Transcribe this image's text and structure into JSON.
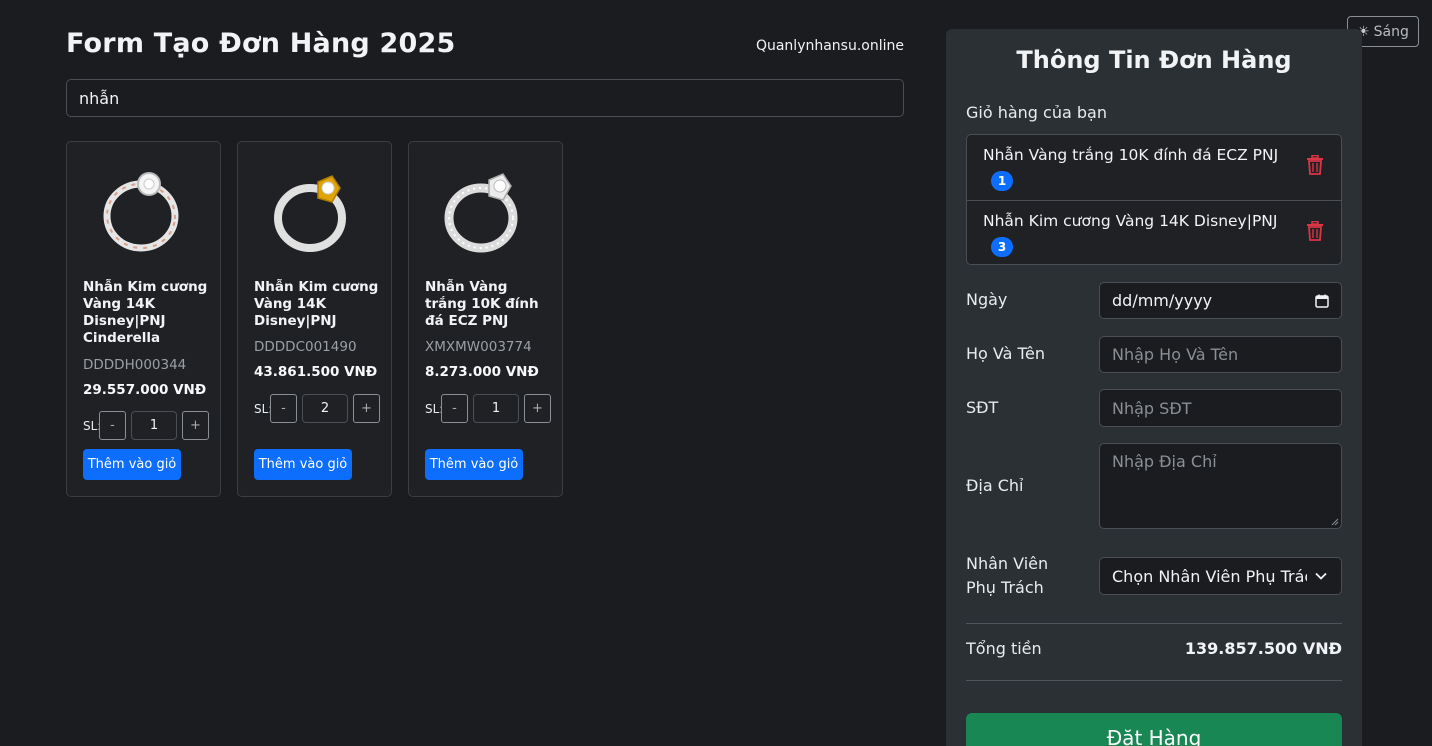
{
  "theme_toggle": {
    "label": "Sáng",
    "icon": "sun-icon"
  },
  "header": {
    "title": "Form Tạo Đơn Hàng 2025",
    "site": "Quanlynhansu.online"
  },
  "search": {
    "value": "nhẫn"
  },
  "products": [
    {
      "name": "Nhẫn Kim cương Vàng 14K Disney|PNJ Cinderella",
      "code": "DDDDH000344",
      "price": "29.557.000 VNĐ",
      "qty_label": "SL:",
      "qty": "1",
      "minus": "-",
      "plus": "+",
      "add_label": "Thêm vào giỏ"
    },
    {
      "name": "Nhẫn Kim cương Vàng 14K Disney|PNJ",
      "code": "DDDDC001490",
      "price": "43.861.500 VNĐ",
      "qty_label": "SL:",
      "qty": "2",
      "minus": "-",
      "plus": "+",
      "add_label": "Thêm vào giỏ"
    },
    {
      "name": "Nhẫn Vàng trắng 10K đính đá ECZ PNJ",
      "code": "XMXMW003774",
      "price": "8.273.000 VNĐ",
      "qty_label": "SL:",
      "qty": "1",
      "minus": "-",
      "plus": "+",
      "add_label": "Thêm vào giỏ"
    }
  ],
  "order": {
    "title": "Thông Tin Đơn Hàng",
    "cart_label": "Giỏ hàng của bạn",
    "cart": [
      {
        "name": "Nhẫn Vàng trắng 10K đính đá ECZ PNJ",
        "qty": "1"
      },
      {
        "name": "Nhẫn Kim cương Vàng 14K Disney|PNJ",
        "qty": "3"
      }
    ],
    "date_label": "Ngày",
    "date_value": "dd/mm/yyyy",
    "name_label": "Họ Và Tên",
    "name_placeholder": "Nhập Họ Và Tên",
    "phone_label": "SĐT",
    "phone_placeholder": "Nhập SĐT",
    "address_label": "Địa Chỉ",
    "address_placeholder": "Nhập Địa Chỉ",
    "staff_label_1": "Nhân Viên",
    "staff_label_2": "Phụ Trách",
    "staff_value": "Chọn Nhân Viên Phụ Trách",
    "total_label": "Tổng tiền",
    "total_value": "139.857.500 VNĐ",
    "submit_label": "Đặt Hàng"
  },
  "colors": {
    "primary": "#0d6efd",
    "success": "#198754",
    "danger": "#dc3545",
    "panel": "#2b3035",
    "background": "#1b1c1f"
  }
}
